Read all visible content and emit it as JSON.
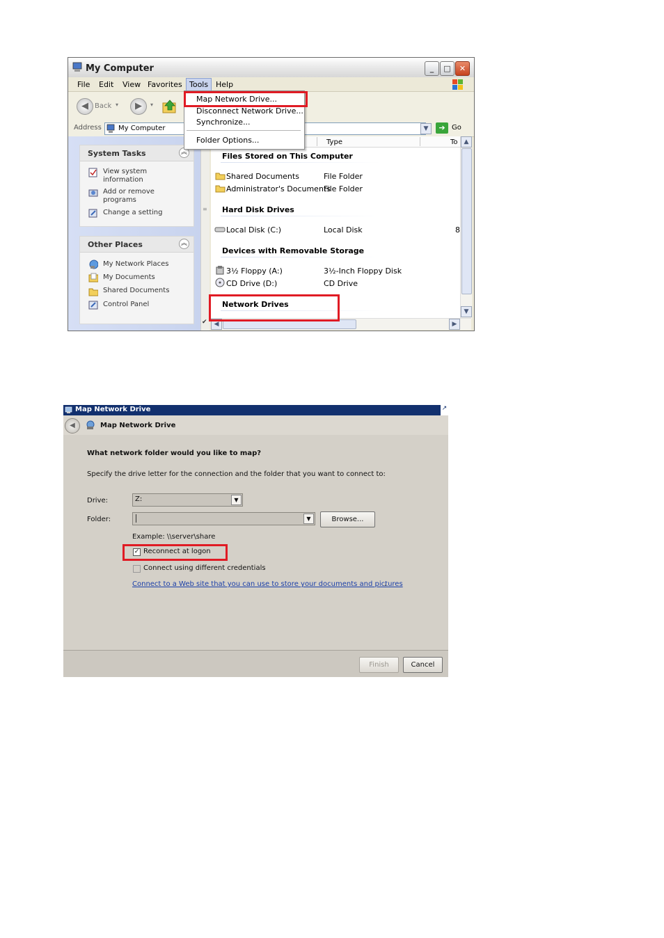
{
  "xp_window": {
    "title": "My Computer",
    "menu": [
      "File",
      "Edit",
      "View",
      "Favorites",
      "Tools",
      "Help"
    ],
    "toolbar": {
      "back": "Back"
    },
    "address": {
      "label": "Address",
      "value": "My Computer",
      "go": "Go"
    },
    "tools_menu": {
      "items": [
        "Map Network Drive...",
        "Disconnect Network Drive...",
        "Synchronize...",
        "Folder Options..."
      ]
    },
    "system_tasks": {
      "title": "System Tasks",
      "items": [
        {
          "line1": "View system",
          "line2": "information"
        },
        {
          "line1": "Add or remove",
          "line2": "programs"
        },
        {
          "line1": "Change a setting",
          "line2": ""
        }
      ]
    },
    "other_places": {
      "title": "Other Places",
      "items": [
        "My Network Places",
        "My Documents",
        "Shared Documents",
        "Control Panel"
      ]
    },
    "columns": {
      "type": "Type",
      "total": "To"
    },
    "groups": [
      {
        "title": "Files Stored on This Computer",
        "rows": [
          {
            "name": "Shared Documents",
            "type": "File Folder"
          },
          {
            "name": "Administrator's Documents",
            "type": "File Folder"
          }
        ]
      },
      {
        "title": "Hard Disk Drives",
        "rows": [
          {
            "name": "Local Disk (C:)",
            "type": "Local Disk",
            "extra": "8"
          }
        ]
      },
      {
        "title": "Devices with Removable Storage",
        "rows": [
          {
            "name": "3½ Floppy (A:)",
            "type": "3½-Inch Floppy Disk"
          },
          {
            "name": "CD Drive (D:)",
            "type": "CD Drive"
          }
        ]
      },
      {
        "title": "Network Drives",
        "rows": []
      }
    ]
  },
  "map_dialog": {
    "title": "Map Network Drive",
    "nav_title": "Map Network Drive",
    "question": "What network folder would you like to map?",
    "instruction": "Specify the drive letter for the connection and the folder that you want to connect to:",
    "drive_label": "Drive:",
    "drive_value": "Z:",
    "folder_label": "Folder:",
    "folder_value": "",
    "browse": "Browse...",
    "example": "Example: \\\\server\\share",
    "reconnect": {
      "label": "Reconnect at logon",
      "checked": true
    },
    "credentials": {
      "label": "Connect using different credentials",
      "checked": false
    },
    "link": "Connect to a Web site that you can use to store your documents and pictures",
    "link_suffix": ".",
    "finish": "Finish",
    "cancel": "Cancel"
  },
  "colors": {
    "highlight_red": "#e01b24",
    "dialog_title": "#12306e",
    "link": "#1b3fa8"
  }
}
